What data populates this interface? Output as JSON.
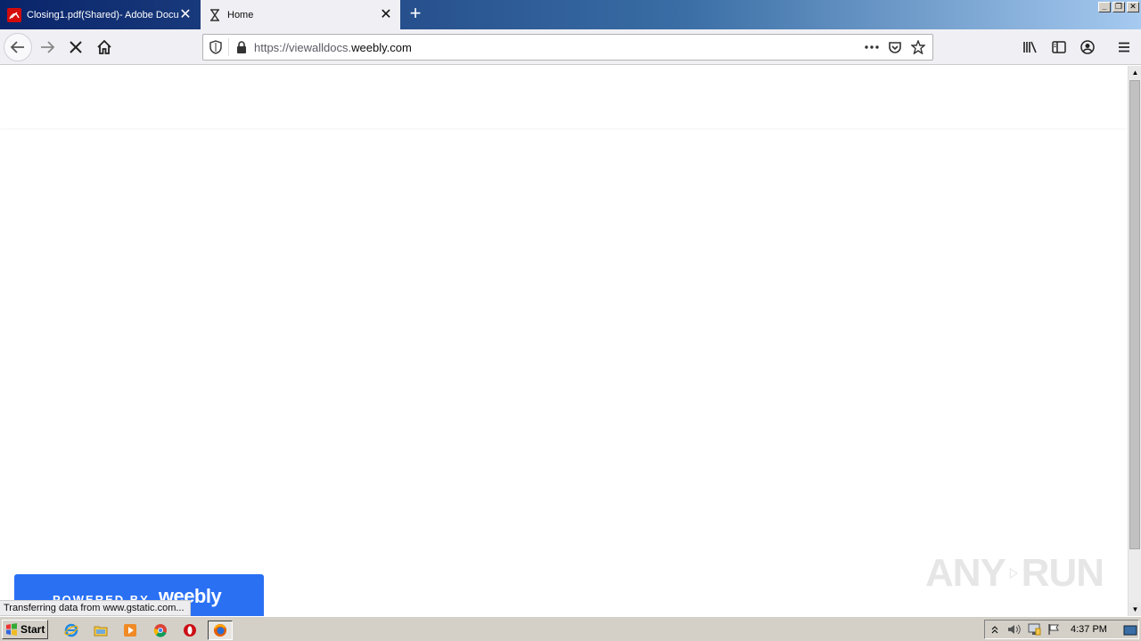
{
  "browser": {
    "tabs": [
      {
        "title": "Closing1.pdf(Shared)- Adobe Docu",
        "active": false,
        "icon": "adobe-pdf-icon"
      },
      {
        "title": "Home",
        "active": true,
        "icon": "hourglass-loading-icon"
      }
    ],
    "url": {
      "prefix": "https://viewalldocs.",
      "domain": "weebly.com"
    }
  },
  "page": {
    "badge": {
      "powered_by": "POWERED BY",
      "brand": "weebly"
    },
    "status": "Transferring data from www.gstatic.com...",
    "watermark": {
      "left": "ANY",
      "right": "RUN"
    }
  },
  "taskbar": {
    "start_label": "Start",
    "clock": "4:37 PM",
    "apps": [
      "internet-explorer-icon",
      "file-explorer-icon",
      "media-player-icon",
      "chrome-icon",
      "opera-icon",
      "firefox-icon"
    ]
  },
  "colors": {
    "accent": "#2a70f3",
    "titlebar_start": "#0a246a",
    "titlebar_end": "#a6caf0",
    "taskbar": "#d4d0c8"
  }
}
